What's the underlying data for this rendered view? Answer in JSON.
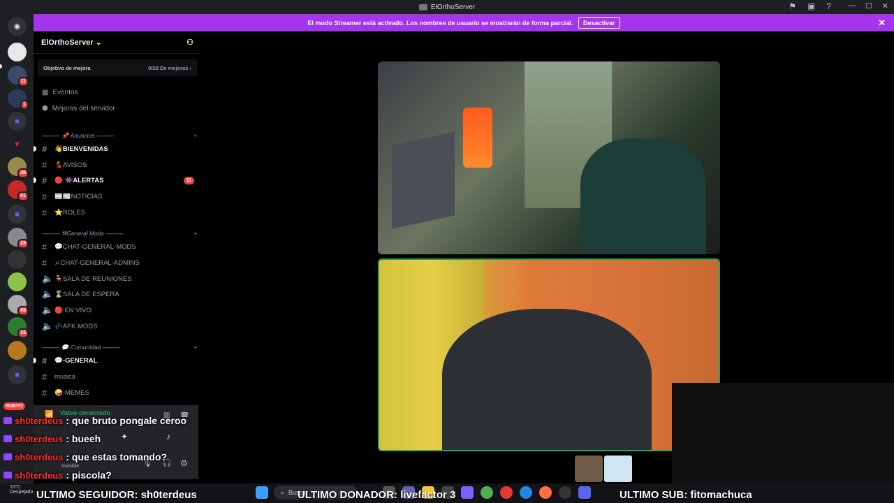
{
  "window": {
    "title": "ElOrthoServer"
  },
  "banner": {
    "text": "El modo Streamer está activado. Los nombres de usuario se mostrarán de forma parcial.",
    "button": "Desactivar"
  },
  "server": {
    "name": "ElOrthoServer"
  },
  "boost": {
    "label": "Objetivo de mejora",
    "progress": "0/28 De mejoras"
  },
  "nav": {
    "events": "Eventos",
    "improvements": "Mejoras del servidor"
  },
  "categories": {
    "announcements": "——— 📌 Anuncios ———",
    "mods": "——— ⚒General Mods ———",
    "community": "——— 💬 Comunidad ———"
  },
  "channels": [
    {
      "label": "👋BIENVENIDAS",
      "unread": true
    },
    {
      "label": "💃AVISOS",
      "unread": false
    },
    {
      "label": "🔴 👾ALERTAS",
      "unread": true,
      "mentions": "11"
    },
    {
      "label": "📰📰NOTICIAS",
      "unread": false
    },
    {
      "label": "⭐ROLES",
      "unread": false
    },
    {
      "label": "💬CHAT-GENERAL-MODS",
      "unread": false
    },
    {
      "label": "⚔CHAT-GENERAL-ADMINS",
      "unread": false
    },
    {
      "label": "🪑SALA DE REUNIONES",
      "unread": false
    },
    {
      "label": "⌛SALA DE ESPERA",
      "unread": false
    },
    {
      "label": "🔴 EN VIVO",
      "unread": false
    },
    {
      "label": "💤AFK MODS",
      "unread": false
    },
    {
      "label": "💬-GENERAL",
      "unread": true
    },
    {
      "label": "musica",
      "unread": false
    },
    {
      "label": "🤪-MEMES",
      "unread": false
    }
  ],
  "server_badges": [
    "11",
    "1",
    "26",
    "61",
    "28",
    "68",
    "16"
  ],
  "new_label": "NUEVO",
  "voice": {
    "status": "Video conectado",
    "user_status": "Invisible"
  },
  "chat": [
    {
      "author": "sh0terdeus",
      "message": ": que bruto pongale ceroo"
    },
    {
      "author": "sh0terdeus",
      "message": ": bueeh"
    },
    {
      "author": "sh0terdeus",
      "message": ": que estas tomando?"
    },
    {
      "author": "sh0terdeus",
      "message": ": piscola?"
    }
  ],
  "ticker": {
    "follower": "ULTIMO SEGUIDOR: sh0terdeus",
    "donor": "ULTIMO DONADOR: livefactor 3",
    "sub": "ULTIMO SUB: fitomachuca"
  },
  "taskbar": {
    "search": "Buscar",
    "weather_temp": "15°C",
    "weather_desc": "Despejado"
  },
  "colors": {
    "accent": "#a335ea",
    "discord_bg": "#1e1f22",
    "mention_red": "#f23f43",
    "speaking_green": "#23a55a"
  }
}
